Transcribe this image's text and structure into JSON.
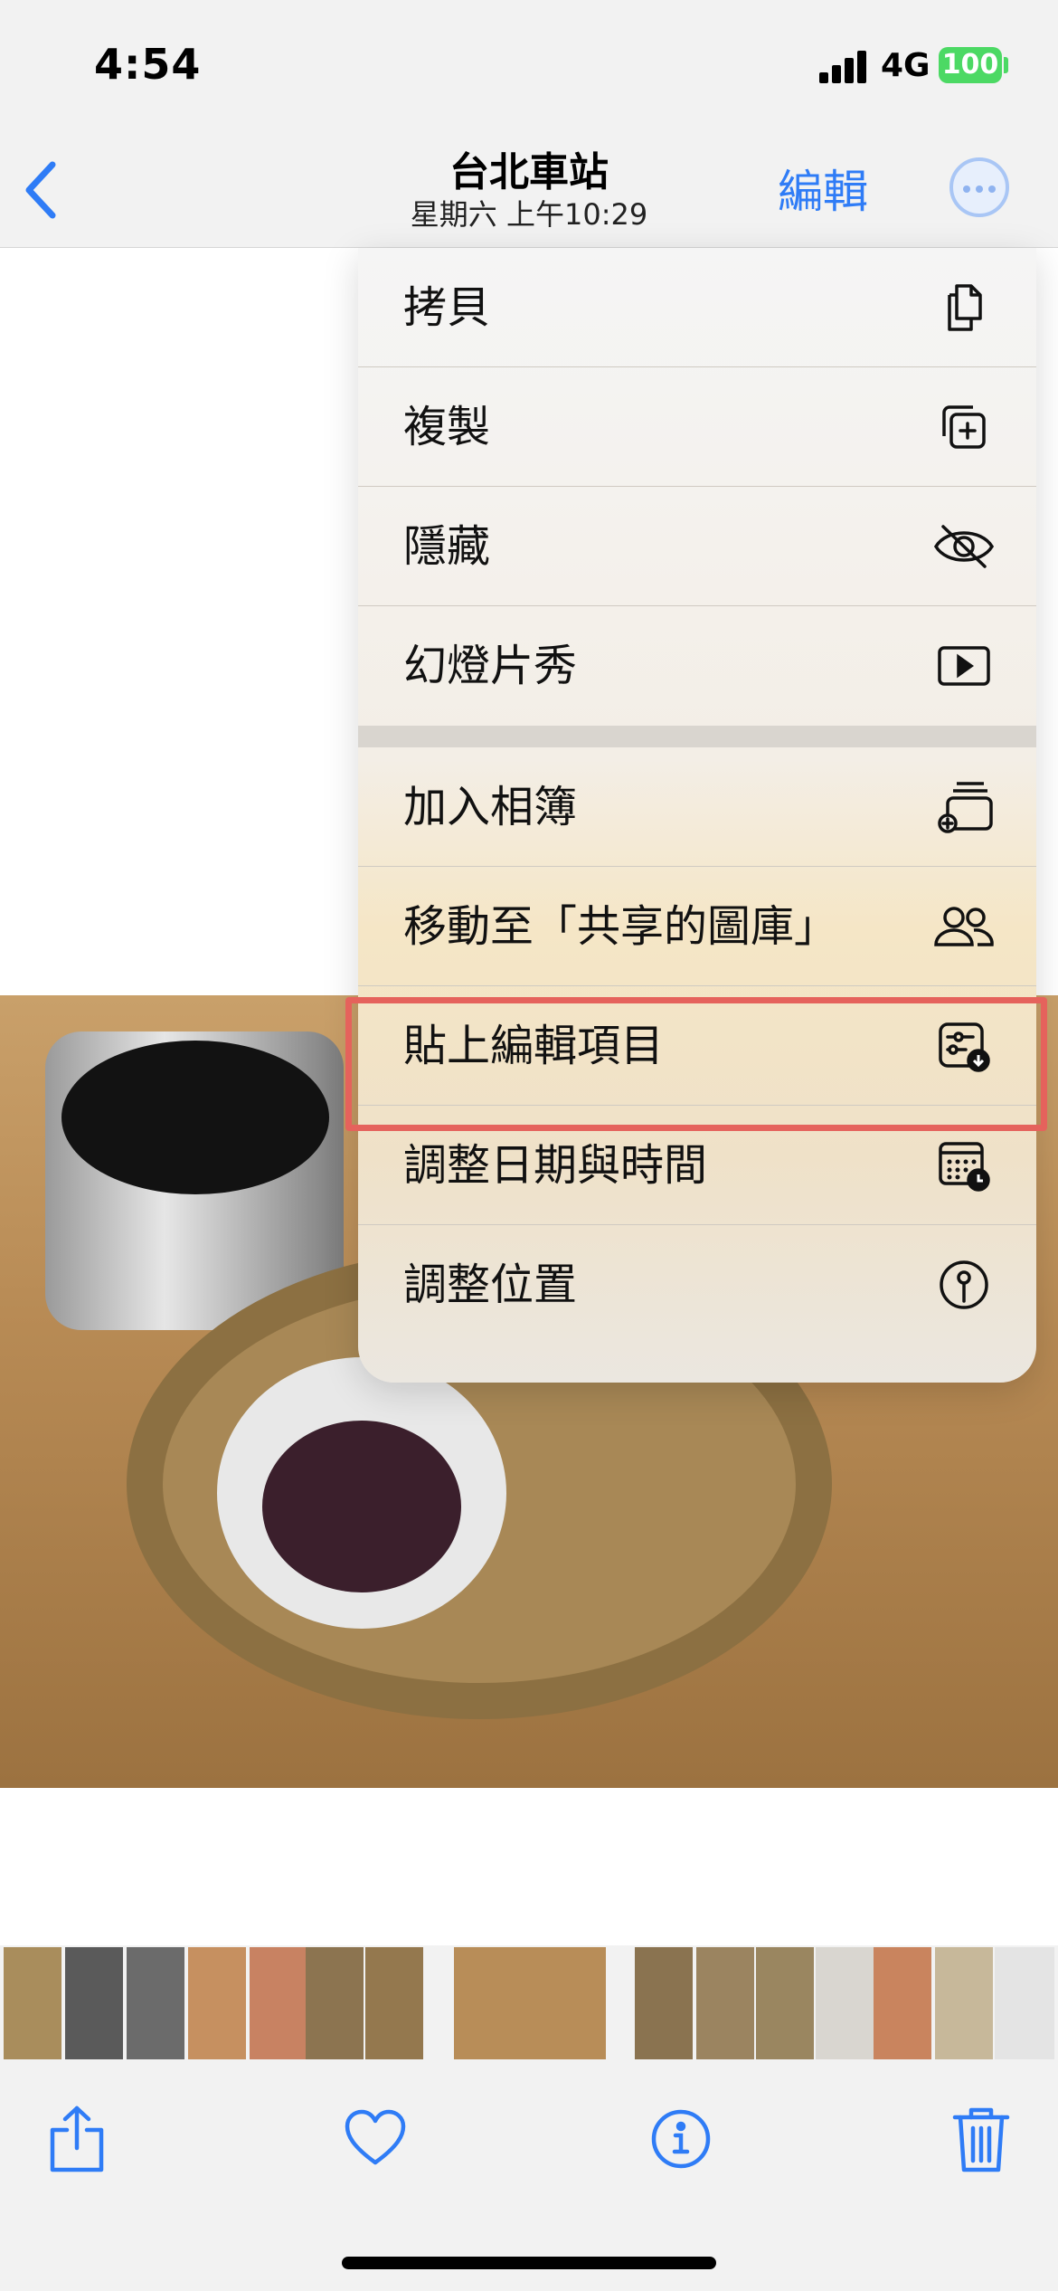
{
  "status_bar": {
    "time": "4:54",
    "network": "4G",
    "battery": "100",
    "battery_color": "#4cd964"
  },
  "nav": {
    "title": "台北車站",
    "subtitle": "星期六  上午10:29",
    "edit_label": "編輯",
    "accent_color": "#2f7cf6",
    "back_icon": "chevron-left-icon",
    "more_icon": "ellipsis-circle-icon"
  },
  "menu": {
    "items": [
      {
        "label": "拷貝",
        "icon": "copy-icon"
      },
      {
        "label": "複製",
        "icon": "duplicate-icon"
      },
      {
        "label": "隱藏",
        "icon": "eye-slash-icon"
      },
      {
        "label": "幻燈片秀",
        "icon": "play-rectangle-icon"
      },
      {
        "label": "加入相簿",
        "icon": "add-to-album-icon"
      },
      {
        "label": "移動至「共享的圖庫」",
        "icon": "people-icon"
      },
      {
        "label": "貼上編輯項目",
        "icon": "paste-edits-icon"
      },
      {
        "label": "調整日期與時間",
        "icon": "calendar-clock-icon"
      },
      {
        "label": "調整位置",
        "icon": "location-pin-icon"
      }
    ],
    "highlighted_item": "貼上編輯項目",
    "highlight_color": "#e5625c"
  },
  "toolbar": {
    "share_icon": "share-icon",
    "favorite_icon": "heart-icon",
    "info_icon": "info-circle-icon",
    "delete_icon": "trash-icon"
  }
}
